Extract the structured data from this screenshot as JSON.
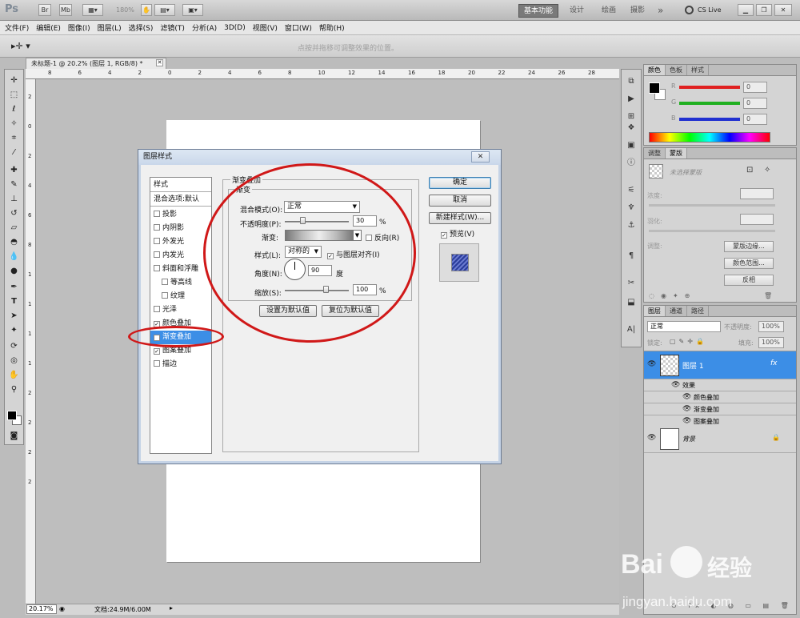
{
  "appbar": {
    "logo": "Ps",
    "zoom": "180%",
    "workspaces": [
      "基本功能",
      "设计",
      "绘画",
      "摄影"
    ],
    "more": "»",
    "cslive": "CS Live"
  },
  "menu": [
    "文件(F)",
    "编辑(E)",
    "图像(I)",
    "图层(L)",
    "选择(S)",
    "滤镜(T)",
    "分析(A)",
    "3D(D)",
    "视图(V)",
    "窗口(W)",
    "帮助(H)"
  ],
  "options": {
    "hint": "点按并拖移可调整效果的位置。"
  },
  "document": {
    "tab_title": "未标题-1 @ 20.2% (图层 1, RGB/8) *",
    "ruler_h": [
      "8",
      "6",
      "4",
      "2",
      "0",
      "2",
      "4",
      "6",
      "8",
      "10",
      "12",
      "14",
      "16",
      "18",
      "20",
      "22",
      "24",
      "26",
      "28"
    ],
    "ruler_v": [
      "2",
      "0",
      "2",
      "4",
      "6",
      "8",
      "1",
      "1",
      "1",
      "1",
      "2",
      "2",
      "2",
      "2"
    ]
  },
  "status": {
    "zoom": "20.17%",
    "docinfo": "文档:24.9M/6.00M"
  },
  "color_panel": {
    "tabs": [
      "颜色",
      "色板",
      "样式"
    ],
    "channels": [
      {
        "label": "R",
        "value": "0",
        "color": "#e02020"
      },
      {
        "label": "G",
        "value": "0",
        "color": "#20b020"
      },
      {
        "label": "B",
        "value": "0",
        "color": "#2030d0"
      }
    ]
  },
  "adjust_panel": {
    "tabs": [
      "调整",
      "蒙版"
    ],
    "no_selection": "未选择蒙版",
    "density": "浓度:",
    "feather": "羽化:",
    "refine": "调整:",
    "mask_edge": "蒙版边缘...",
    "color_range": "颜色范围...",
    "invert": "反相"
  },
  "layers_panel": {
    "tabs": [
      "图层",
      "通道",
      "路径"
    ],
    "blend": "正常",
    "opacity_label": "不透明度:",
    "opacity": "100%",
    "lock_label": "锁定:",
    "fill_label": "填充:",
    "fill": "100%",
    "layer1": "图层 1",
    "fx": "fx",
    "effects": "效果",
    "effect_items": [
      "颜色叠加",
      "渐变叠加",
      "图案叠加"
    ],
    "background": "背景"
  },
  "dialog": {
    "title": "图层样式",
    "close": "✕",
    "styles_header": "样式",
    "blend_defaults": "混合选项:默认",
    "items": [
      {
        "label": "投影",
        "checked": false,
        "indent": false,
        "selected": false
      },
      {
        "label": "内阴影",
        "checked": false,
        "indent": false,
        "selected": false
      },
      {
        "label": "外发光",
        "checked": false,
        "indent": false,
        "selected": false
      },
      {
        "label": "内发光",
        "checked": false,
        "indent": false,
        "selected": false
      },
      {
        "label": "斜面和浮雕",
        "checked": false,
        "indent": false,
        "selected": false
      },
      {
        "label": "等高线",
        "checked": false,
        "indent": true,
        "selected": false
      },
      {
        "label": "纹理",
        "checked": false,
        "indent": true,
        "selected": false
      },
      {
        "label": "光泽",
        "checked": false,
        "indent": false,
        "selected": false
      },
      {
        "label": "颜色叠加",
        "checked": true,
        "indent": false,
        "selected": false
      },
      {
        "label": "渐变叠加",
        "checked": true,
        "indent": false,
        "selected": true
      },
      {
        "label": "图案叠加",
        "checked": true,
        "indent": false,
        "selected": false
      },
      {
        "label": "描边",
        "checked": false,
        "indent": false,
        "selected": false
      }
    ],
    "group_title": "渐变叠加",
    "sub_title": "渐变",
    "blend_mode_label": "混合模式(O):",
    "blend_mode": "正常",
    "opacity_label": "不透明度(P):",
    "opacity": "30",
    "opacity_pct": 0.3,
    "percent": "%",
    "gradient_label": "渐变:",
    "reverse": "反向(R)",
    "style_label": "样式(L):",
    "style": "对称的",
    "align": "与图层对齐(I)",
    "angle_label": "角度(N):",
    "angle": "90",
    "degree": "度",
    "scale_label": "缩放(S):",
    "scale": "100",
    "scale_pct": 1.0,
    "set_default": "设置为默认值",
    "reset_default": "复位为默认值",
    "ok": "确定",
    "cancel": "取消",
    "new_style": "新建样式(W)...",
    "preview": "预览(V)"
  },
  "watermark": {
    "brand": "Bai",
    "brand2": "经验",
    "url": "jingyan.baidu.com"
  }
}
